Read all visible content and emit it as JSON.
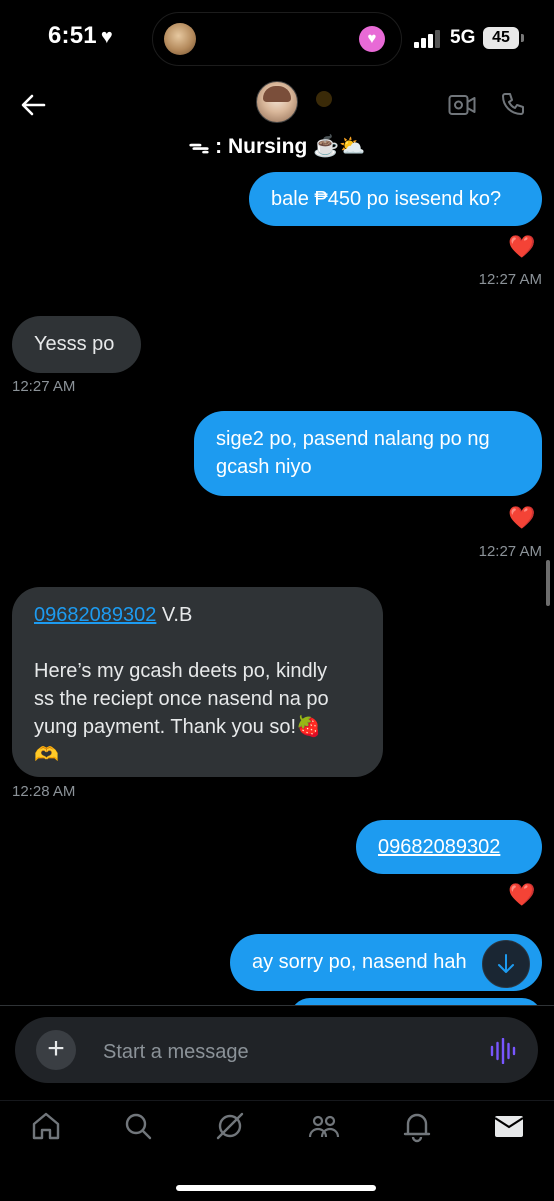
{
  "status": {
    "time": "6:51",
    "time_heart": "♥",
    "network": "5G",
    "battery": "45"
  },
  "header": {
    "title": "ᯓ : Nursing ☕️⛅️"
  },
  "messages": [
    {
      "text": "bale ₱450 po isesend ko?",
      "reaction": "❤️",
      "time": "12:27 AM"
    },
    {
      "text": "Yesss po",
      "time": "12:27 AM"
    },
    {
      "line1": "sige2 po, pasend nalang po ng",
      "line2": "gcash niyo",
      "reaction": "❤️",
      "time": "12:27 AM"
    },
    {
      "number": "09682089302",
      "suffix": " V.B",
      "line1": "Here’s my gcash deets po, kindly",
      "line2": "ss the reciept once nasend na po",
      "line3": "yung payment. Thank you so!🍓",
      "line4": "🫶",
      "time": "12:28 AM"
    },
    {
      "number": "09682089302",
      "reaction": "❤️"
    },
    {
      "text": "ay sorry po, nasend hah"
    }
  ],
  "composer": {
    "placeholder": "Start a message"
  },
  "icons": {
    "back": "arrow-left-icon",
    "video": "video-call-icon",
    "phone": "phone-call-icon",
    "plus": "plus-icon",
    "voice": "voice-wave-icon",
    "scroll_down": "arrow-down-icon",
    "tabs": [
      "home-icon",
      "search-icon",
      "grok-icon",
      "communities-icon",
      "notifications-icon",
      "messages-icon"
    ]
  },
  "colors": {
    "accent": "#1d9bf0",
    "received_bubble": "#2f3336",
    "voice": "#7856ff",
    "reaction": "#f4212e"
  }
}
